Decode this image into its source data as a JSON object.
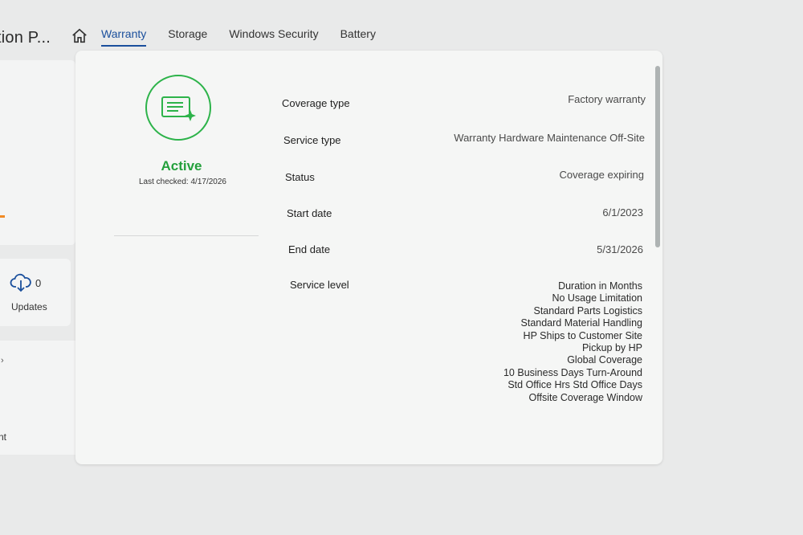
{
  "header": {
    "app_title": "tion P...",
    "tabs": [
      {
        "label": "Warranty",
        "active": true
      },
      {
        "label": "Storage",
        "active": false
      },
      {
        "label": "Windows Security",
        "active": false
      },
      {
        "label": "Battery",
        "active": false
      }
    ]
  },
  "left_cards": {
    "updates_count": "0",
    "updates_label": "Updates",
    "chevron": "›",
    "partial_text": "nt"
  },
  "warranty": {
    "status": "Active",
    "last_checked": "Last checked: 4/17/2026",
    "status_color": "#2db34a",
    "fields": [
      {
        "label": "Coverage type",
        "value": "Factory warranty"
      },
      {
        "label": "Service type",
        "value": "Warranty Hardware Maintenance Off-Site"
      },
      {
        "label": "Status",
        "value": "Coverage expiring"
      },
      {
        "label": "Start date",
        "value": "6/1/2023"
      },
      {
        "label": "End date",
        "value": "5/31/2026"
      }
    ],
    "service_level_label": "Service level",
    "service_levels": [
      "Duration in Months",
      "No Usage Limitation",
      "Standard Parts Logistics",
      "Standard Material Handling",
      "HP Ships to Customer Site",
      "Pickup by HP",
      "Global Coverage",
      "10 Business Days Turn-Around",
      "Std Office Hrs Std Office Days",
      "Offsite Coverage Window"
    ]
  },
  "colors": {
    "accent": "#1a4f9c",
    "active_green": "#24a03c"
  }
}
